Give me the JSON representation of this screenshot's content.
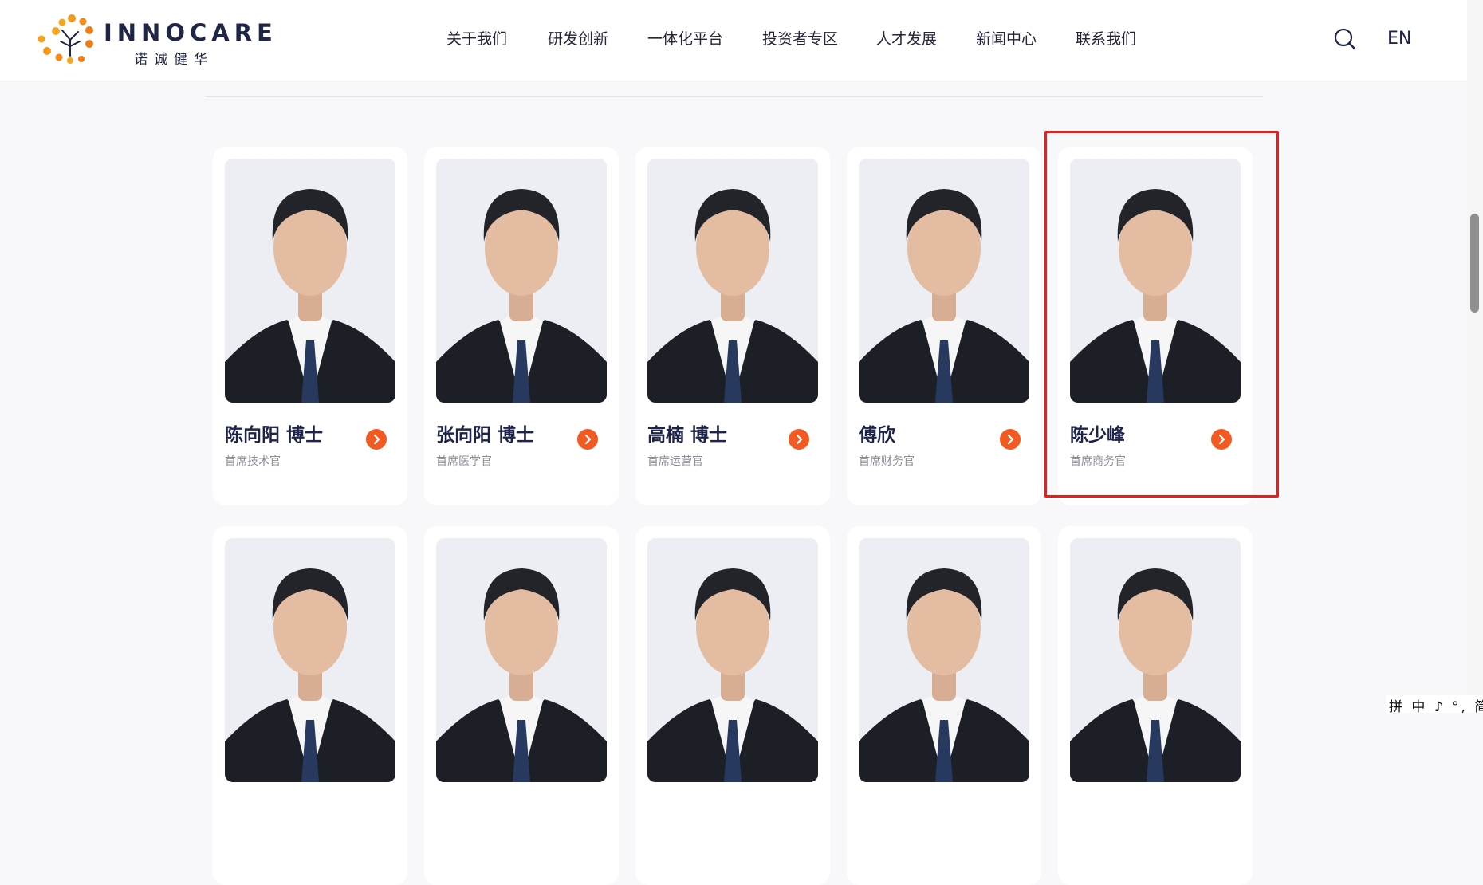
{
  "header": {
    "brand_en": "INNOCARE",
    "brand_cn": "诺诚健华",
    "nav": [
      "关于我们",
      "研发创新",
      "一体化平台",
      "投资者专区",
      "人才发展",
      "新闻中心",
      "联系我们"
    ],
    "lang": "EN",
    "search_icon": "search-icon"
  },
  "colors": {
    "accent": "#f25a22",
    "highlight": "#e3201b",
    "text_dark": "#1d2349"
  },
  "team": [
    {
      "name": "陈向阳 博士",
      "title": "首席技术官"
    },
    {
      "name": "张向阳 博士",
      "title": "首席医学官"
    },
    {
      "name": "高楠 博士",
      "title": "首席运营官"
    },
    {
      "name": "傅欣",
      "title": "首席财务官"
    },
    {
      "name": "陈少峰",
      "title": "首席商务官"
    }
  ],
  "ime": {
    "text": "拼 中 ♪ °, 简"
  }
}
